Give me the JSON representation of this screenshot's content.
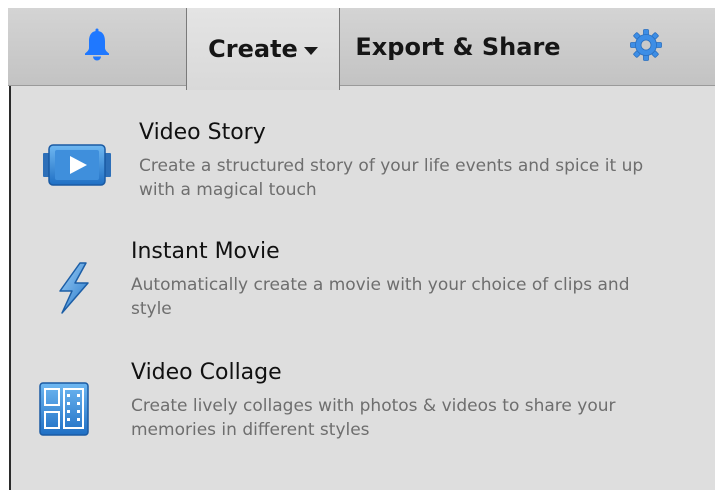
{
  "toolbar": {
    "notifications_icon": "bell-icon",
    "create_label": "Create",
    "create_caret_icon": "caret-down-icon",
    "export_label": "Export & Share",
    "settings_icon": "gear-icon",
    "bell_color": "#1f78ff",
    "gear_color": "#3d8ee6"
  },
  "create_menu": {
    "items": [
      {
        "title": "Video Story",
        "description": "Create a structured story of your life events and spice it up with a magical touch",
        "icon": "video-story-icon"
      },
      {
        "title": "Instant Movie",
        "description": "Automatically create a movie with your choice of clips and style",
        "icon": "lightning-bolt-icon"
      },
      {
        "title": "Video Collage",
        "description": "Create lively collages with photos & videos to share your memories in different styles",
        "icon": "video-collage-icon"
      }
    ]
  }
}
